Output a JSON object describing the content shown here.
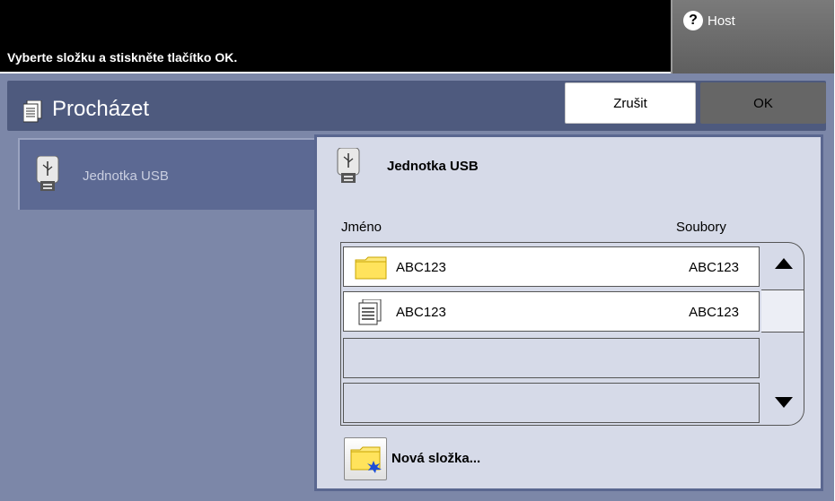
{
  "header": {
    "message": "Vyberte složku a stiskněte tlačítko OK.",
    "host_label": "Host",
    "help_icon": "question-icon"
  },
  "titlebar": {
    "title": "Procházet",
    "icon": "document-icon"
  },
  "buttons": {
    "cancel": "Zrušit",
    "ok": "OK"
  },
  "left_panel": {
    "items": [
      {
        "label": "Jednotka USB",
        "icon": "usb-icon"
      }
    ]
  },
  "right_panel": {
    "heading": "Jednotka USB",
    "icon": "usb-icon",
    "columns": {
      "name": "Jméno",
      "files": "Soubory"
    },
    "rows": [
      {
        "icon": "folder-icon",
        "name": "ABC123",
        "files": "ABC123"
      },
      {
        "icon": "document-icon",
        "name": "ABC123",
        "files": "ABC123"
      }
    ],
    "new_folder_label": "Nová složka..."
  },
  "colors": {
    "background": "#7c87a8",
    "titlebar": "#4e5a7e",
    "panel": "#d6dae8",
    "ok_button": "#666666"
  }
}
